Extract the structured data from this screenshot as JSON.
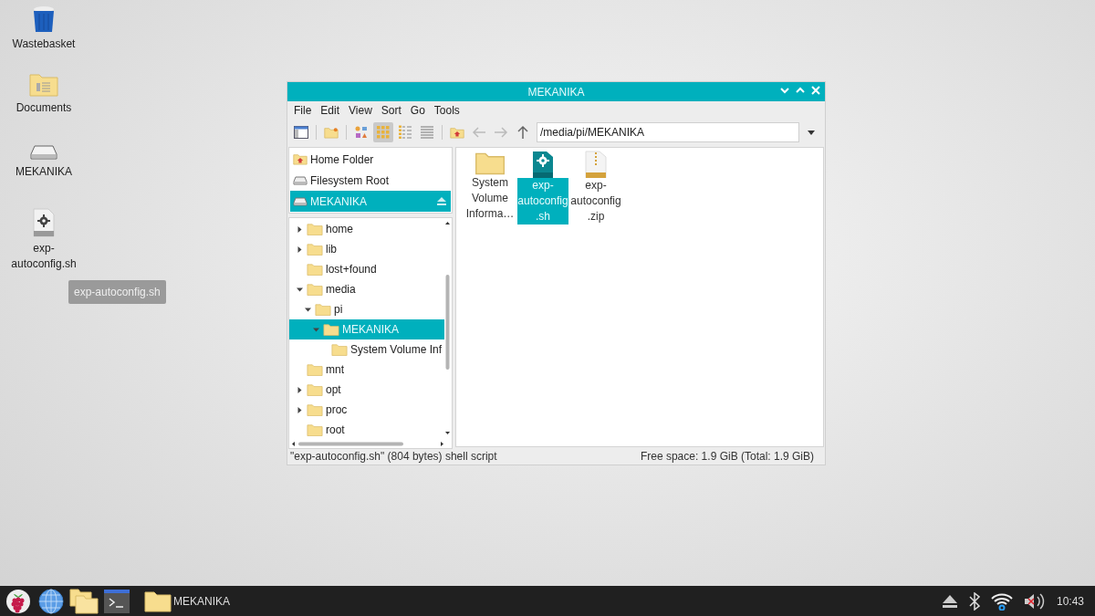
{
  "desktop": {
    "icons": [
      {
        "label": "Wastebasket",
        "kind": "trash"
      },
      {
        "label": "Documents",
        "kind": "documents"
      },
      {
        "label": "MEKANIKA",
        "kind": "drive"
      },
      {
        "label": "exp-autoconfig.sh",
        "kind": "script"
      }
    ],
    "tooltip": "exp-autoconfig.sh"
  },
  "window": {
    "title": "MEKANIKA",
    "menu": [
      "File",
      "Edit",
      "View",
      "Sort",
      "Go",
      "Tools"
    ],
    "view_modes": [
      {
        "kind": "thumbnails",
        "selected": false
      },
      {
        "kind": "icons",
        "selected": true
      },
      {
        "kind": "compact",
        "selected": false
      },
      {
        "kind": "list",
        "selected": false
      }
    ],
    "path": "/media/pi/MEKANIKA",
    "places": [
      {
        "label": "Home Folder",
        "kind": "home",
        "selected": false
      },
      {
        "label": "Filesystem Root",
        "kind": "drive",
        "selected": false
      },
      {
        "label": "MEKANIKA",
        "kind": "drive",
        "selected": true,
        "ejectable": true
      }
    ],
    "tree": [
      {
        "label": "home",
        "has_children": true,
        "expanded": false,
        "selected": false
      },
      {
        "label": "lib",
        "has_children": true,
        "expanded": false,
        "selected": false
      },
      {
        "label": "lost+found",
        "has_children": false,
        "selected": false
      },
      {
        "label": "media",
        "has_children": true,
        "expanded": true,
        "selected": false,
        "children": [
          {
            "label": "pi",
            "has_children": true,
            "expanded": true,
            "selected": false,
            "children": [
              {
                "label": "MEKANIKA",
                "has_children": true,
                "expanded": true,
                "selected": true,
                "children": [
                  {
                    "label": "System Volume Inf",
                    "has_children": false,
                    "selected": false
                  }
                ]
              }
            ]
          }
        ]
      },
      {
        "label": "mnt",
        "has_children": false,
        "selected": false
      },
      {
        "label": "opt",
        "has_children": true,
        "expanded": false,
        "selected": false
      },
      {
        "label": "proc",
        "has_children": true,
        "expanded": false,
        "selected": false
      },
      {
        "label": "root",
        "has_children": false,
        "selected": false
      }
    ],
    "files": [
      {
        "label": "System Volume Informa…",
        "kind": "folder",
        "selected": false
      },
      {
        "label": "exp-autoconfig.sh",
        "kind": "script",
        "selected": true
      },
      {
        "label": "exp-autoconfig.zip",
        "kind": "zip",
        "selected": false
      }
    ],
    "status_bar": {
      "left": "\"exp-autoconfig.sh\" (804 bytes) shell script",
      "right": "Free space: 1.9 GiB (Total: 1.9 GiB)"
    }
  },
  "taskbar": {
    "launchers": [
      {
        "kind": "raspberry"
      },
      {
        "kind": "browser"
      },
      {
        "kind": "files"
      },
      {
        "kind": "terminal"
      }
    ],
    "windows": [
      {
        "label": "MEKANIKA",
        "selected": false
      }
    ],
    "tray": {
      "muted": true,
      "clock": "10:43"
    }
  }
}
